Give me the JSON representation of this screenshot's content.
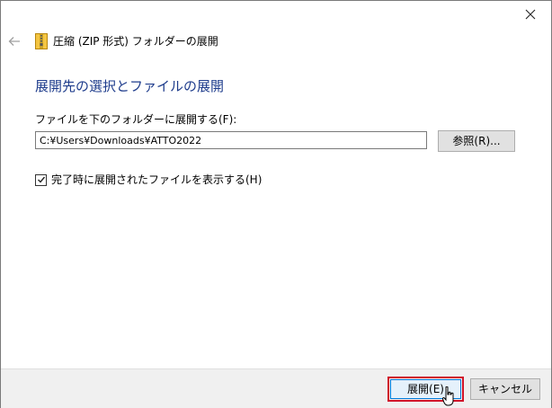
{
  "dialog": {
    "title": "圧縮 (ZIP 形式) フォルダーの展開",
    "heading": "展開先の選択とファイルの展開",
    "path_label": "ファイルを下のフォルダーに展開する(F):",
    "path_value": "C:¥Users¥Downloads¥ATTO2022",
    "browse_label": "参照(R)...",
    "show_files_label": "完了時に展開されたファイルを表示する(H)",
    "show_files_checked": true
  },
  "footer": {
    "extract_label": "展開(E)",
    "cancel_label": "キャンセル"
  },
  "icons": {
    "close": "close-icon",
    "back": "back-arrow-icon",
    "zip": "zip-folder-icon",
    "check": "checkmark-icon",
    "cursor": "mouse-cursor-icon"
  },
  "colors": {
    "heading": "#1e3c8c",
    "focus_highlight": "#d0142b",
    "default_button_border": "#0078d7",
    "footer_bg": "#f0f0f0"
  }
}
